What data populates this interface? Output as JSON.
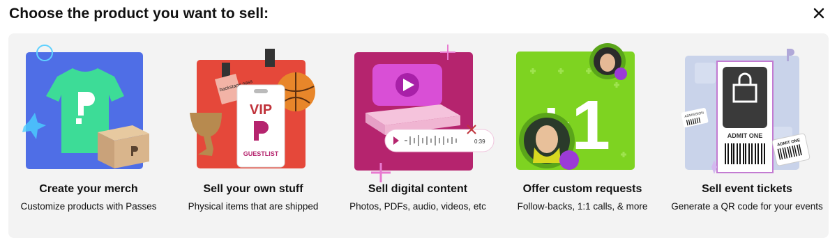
{
  "header": {
    "title": "Choose the product you want to sell:",
    "close_icon": "close-icon"
  },
  "cards": [
    {
      "title": "Create your merch",
      "subtitle": "Customize products with Passes",
      "icon": "tshirt-box-icon",
      "color": "#4f6ee6"
    },
    {
      "title": "Sell your own stuff",
      "subtitle": "Physical items that are shipped",
      "icon": "vip-pass-icon",
      "color": "#e5483a"
    },
    {
      "title": "Sell digital content",
      "subtitle": "Photos, PDFs, audio, videos, etc",
      "icon": "video-play-icon",
      "color": "#b5246e"
    },
    {
      "title": "Offer custom requests",
      "subtitle": "Follow-backs, 1:1 calls, & more",
      "icon": "plus-one-icon",
      "color": "#7ed321"
    },
    {
      "title": "Sell event tickets",
      "subtitle": "Generate a QR code for your events",
      "icon": "ticket-icon",
      "color": "#c9d3ea"
    }
  ],
  "art_text": {
    "vip": "VIP",
    "guestlist": "GUESTLIST",
    "backstage": "backstage pass",
    "audio_time": "0:39",
    "plus_one": "+1",
    "admit_one": "ADMIT ONE",
    "admission": "ADMISSION"
  }
}
